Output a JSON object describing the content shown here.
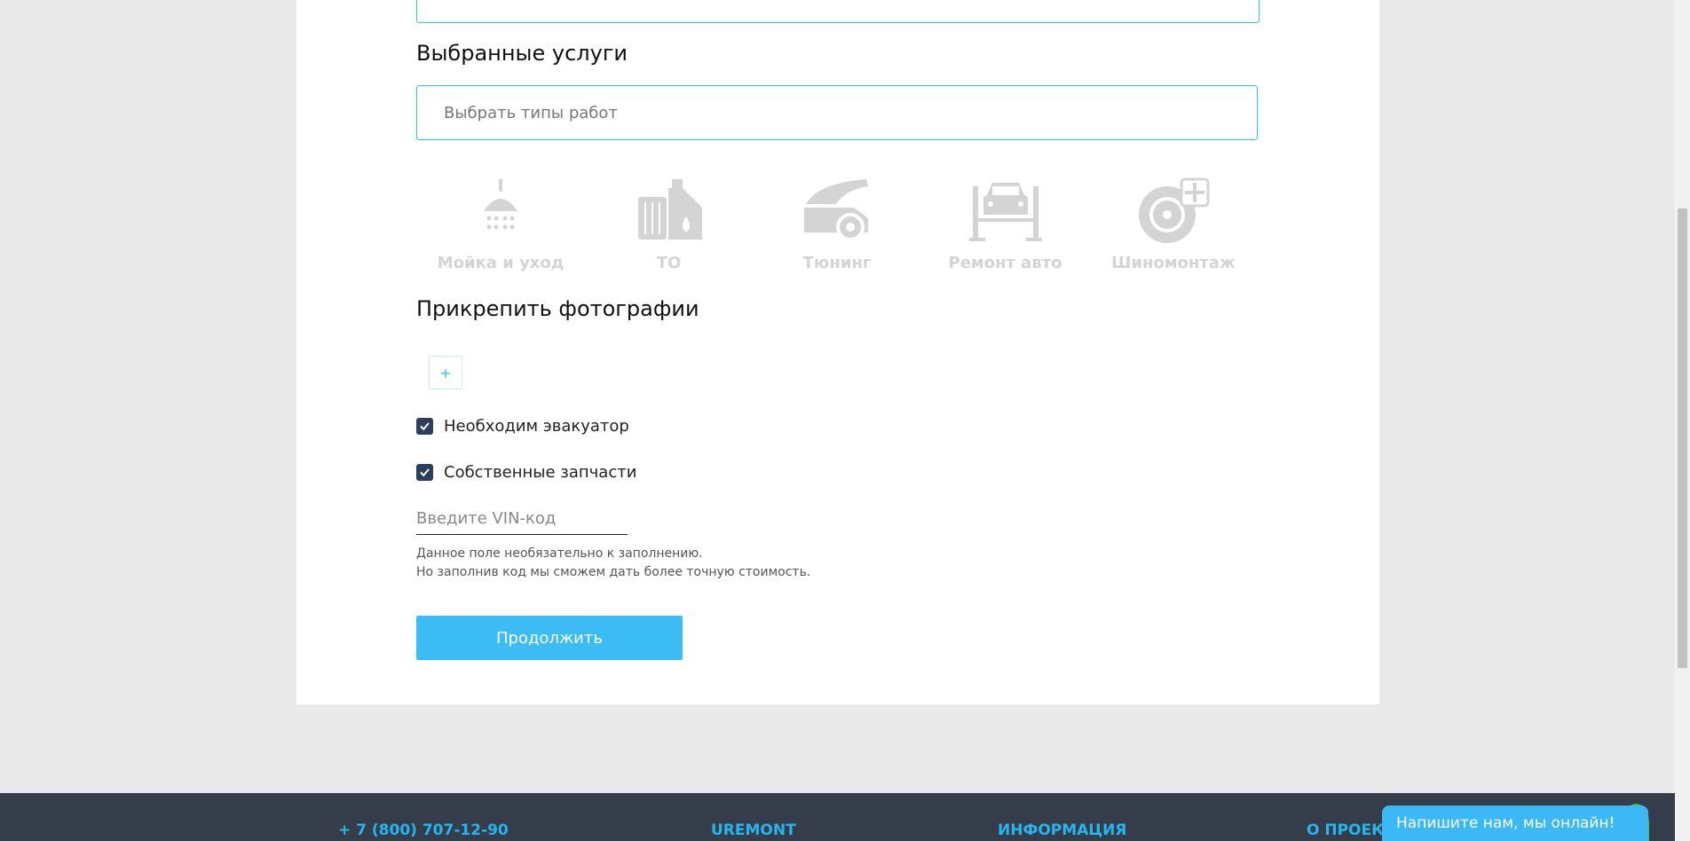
{
  "form": {
    "services_title": "Выбранные услуги",
    "services_placeholder": "Выбрать типы работ",
    "categories": [
      {
        "label": "Мойка и уход",
        "icon": "shower-icon"
      },
      {
        "label": "ТО",
        "icon": "oil-filter-icon"
      },
      {
        "label": "Тюнинг",
        "icon": "car-tuning-icon"
      },
      {
        "label": "Ремонт авто",
        "icon": "car-lift-icon"
      },
      {
        "label": "Шиномонтаж",
        "icon": "tire-icon"
      }
    ],
    "photos_title": "Прикрепить фотографии",
    "add_photo_label": "+",
    "tow_truck_label": "Необходим эвакуатор",
    "own_parts_label": "Собственные запчасти",
    "tow_truck_checked": true,
    "own_parts_checked": true,
    "vin_placeholder": "Введите VIN-код",
    "hint_line1": "Данное поле необязательно к заполнению.",
    "hint_line2": "Но заполнив код мы сможем дать более точную стоимость.",
    "continue_label": "Продолжить"
  },
  "footer": {
    "phone": "+ 7 (800) 707-12-90",
    "col_uremont": "UREMONT",
    "col_info": "ИНФОРМАЦИЯ",
    "col_about": "О ПРОЕКТ"
  },
  "chat": {
    "label": "Напишите нам, мы онлайн!"
  },
  "colors": {
    "accent": "#2ec4f0",
    "button": "#3bbcf5",
    "checkbox": "#2c3e5c",
    "footer": "#363d4a"
  }
}
